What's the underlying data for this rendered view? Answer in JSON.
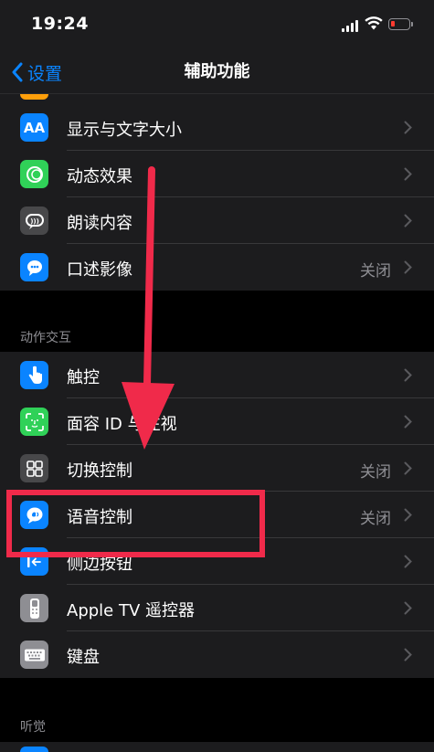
{
  "status_bar": {
    "time": "19:24",
    "battery_color": "#ff3b30"
  },
  "nav": {
    "back_label": "设置",
    "title": "辅助功能"
  },
  "vision_group": {
    "items": [
      {
        "label": "显示与文字大小",
        "value": "",
        "icon": "text-size-icon",
        "icon_text": "AA",
        "color": "#0a84ff"
      },
      {
        "label": "动态效果",
        "value": "",
        "icon": "motion-icon",
        "color": "#30d158"
      },
      {
        "label": "朗读内容",
        "value": "",
        "icon": "spoken-content-icon",
        "color": "#48484a"
      },
      {
        "label": "口述影像",
        "value": "关闭",
        "icon": "audio-description-icon",
        "color": "#0a84ff"
      }
    ]
  },
  "interaction_group": {
    "header": "动作交互",
    "items": [
      {
        "label": "触控",
        "value": "",
        "icon": "touch-icon",
        "color": "#0a84ff"
      },
      {
        "label": "面容 ID 与注视",
        "value": "",
        "icon": "face-id-icon",
        "color": "#30d158"
      },
      {
        "label": "切换控制",
        "value": "关闭",
        "icon": "switch-control-icon",
        "color": "#48484a"
      },
      {
        "label": "语音控制",
        "value": "关闭",
        "icon": "voice-control-icon",
        "color": "#0a84ff"
      },
      {
        "label": "侧边按钮",
        "value": "",
        "icon": "side-button-icon",
        "color": "#0a84ff"
      },
      {
        "label": "Apple TV 遥控器",
        "value": "",
        "icon": "apple-tv-remote-icon",
        "color": "#8e8e93"
      },
      {
        "label": "键盘",
        "value": "",
        "icon": "keyboard-icon",
        "color": "#8e8e93"
      }
    ]
  },
  "hearing_group": {
    "header": "听觉"
  },
  "annotation": {
    "color": "#f02a4a"
  }
}
